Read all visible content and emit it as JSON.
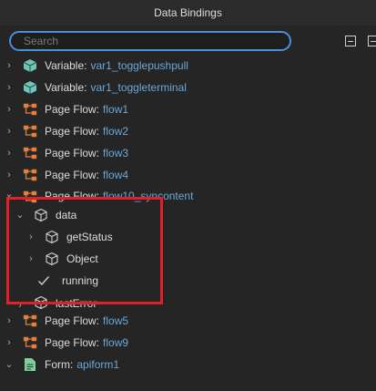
{
  "window": {
    "title": "Data Bindings"
  },
  "search": {
    "placeholder": "Search"
  },
  "tree": [
    {
      "kind": "Variable:",
      "name": "var1_togglepushpull",
      "icon": "cube-icon"
    },
    {
      "kind": "Variable:",
      "name": "var1_toggleterminal",
      "icon": "cube-icon"
    },
    {
      "kind": "Page Flow:",
      "name": "flow1",
      "icon": "flow-icon"
    },
    {
      "kind": "Page Flow:",
      "name": "flow2",
      "icon": "flow-icon"
    },
    {
      "kind": "Page Flow:",
      "name": "flow3",
      "icon": "flow-icon"
    },
    {
      "kind": "Page Flow:",
      "name": "flow4",
      "icon": "flow-icon"
    },
    {
      "kind": "Page Flow:",
      "name": "flow10_syncontent",
      "icon": "flow-icon"
    },
    {
      "label": "data",
      "icon": "object-icon",
      "expanded": true
    },
    {
      "label": "getStatus",
      "icon": "object-icon"
    },
    {
      "label": "Object",
      "icon": "object-icon"
    },
    {
      "label": "running",
      "icon": "check-icon"
    },
    {
      "label": "lastError",
      "icon": "object-icon"
    },
    {
      "kind": "Page Flow:",
      "name": "flow5",
      "icon": "flow-icon"
    },
    {
      "kind": "Page Flow:",
      "name": "flow9",
      "icon": "flow-icon"
    },
    {
      "kind": "Form:",
      "name": "apiform1",
      "icon": "form-icon",
      "expanded": true
    }
  ],
  "colors": {
    "accent": "#4a90d9",
    "link": "#6aa7d8",
    "flow_icon": "#e3813a",
    "variable_icon": "#6fc6b6",
    "form_icon": "#7fcf9a",
    "highlight": "#e0212b"
  }
}
